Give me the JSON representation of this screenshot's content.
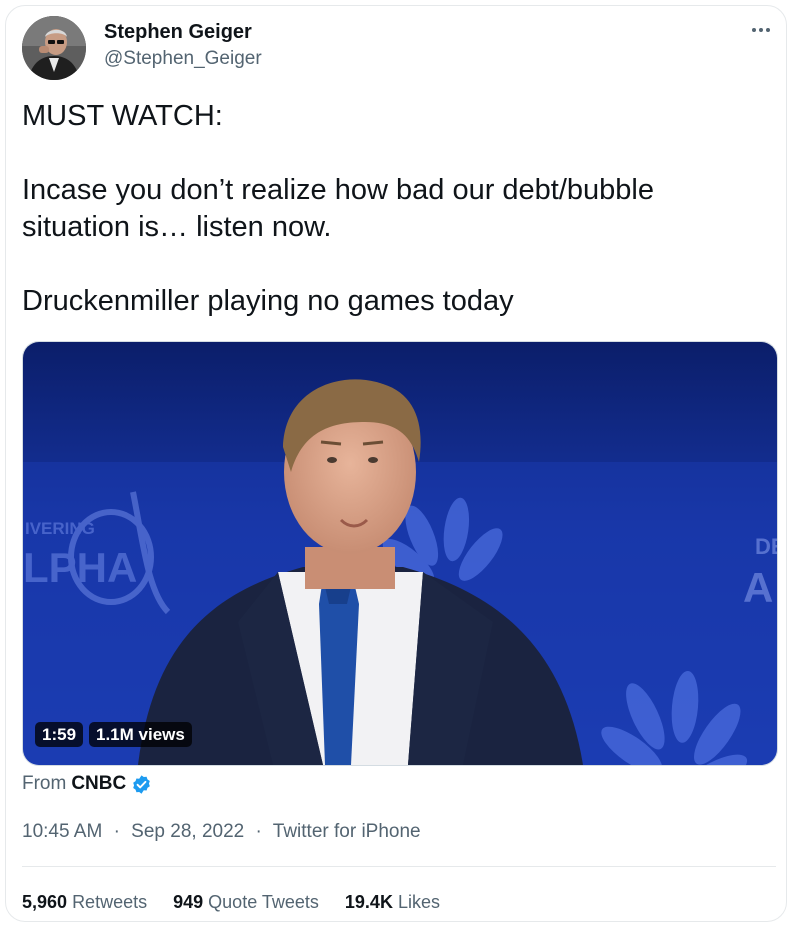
{
  "author": {
    "name": "Stephen Geiger",
    "handle": "@Stephen_Geiger"
  },
  "tweet": {
    "text": "MUST WATCH:\n\nIncase you don’t realize how bad our debt/bubble situation is… listen now.\n\nDruckenmiller playing no games today"
  },
  "media": {
    "duration": "1:59",
    "views": "1.1M views",
    "left_sign": "IVERING\nLPHA",
    "right_sign": "DEL\nA"
  },
  "source": {
    "prefix": "From",
    "name": "CNBC"
  },
  "meta": {
    "time": "10:45 AM",
    "date": "Sep 28, 2022",
    "client": "Twitter for iPhone",
    "sep": "·"
  },
  "stats": {
    "retweets_count": "5,960",
    "retweets_label": "Retweets",
    "quotes_count": "949",
    "quotes_label": "Quote Tweets",
    "likes_count": "19.4K",
    "likes_label": "Likes"
  },
  "colors": {
    "verified": "#1d9bf0",
    "muted": "#536471",
    "stage_blue": "#1c3a9c"
  }
}
